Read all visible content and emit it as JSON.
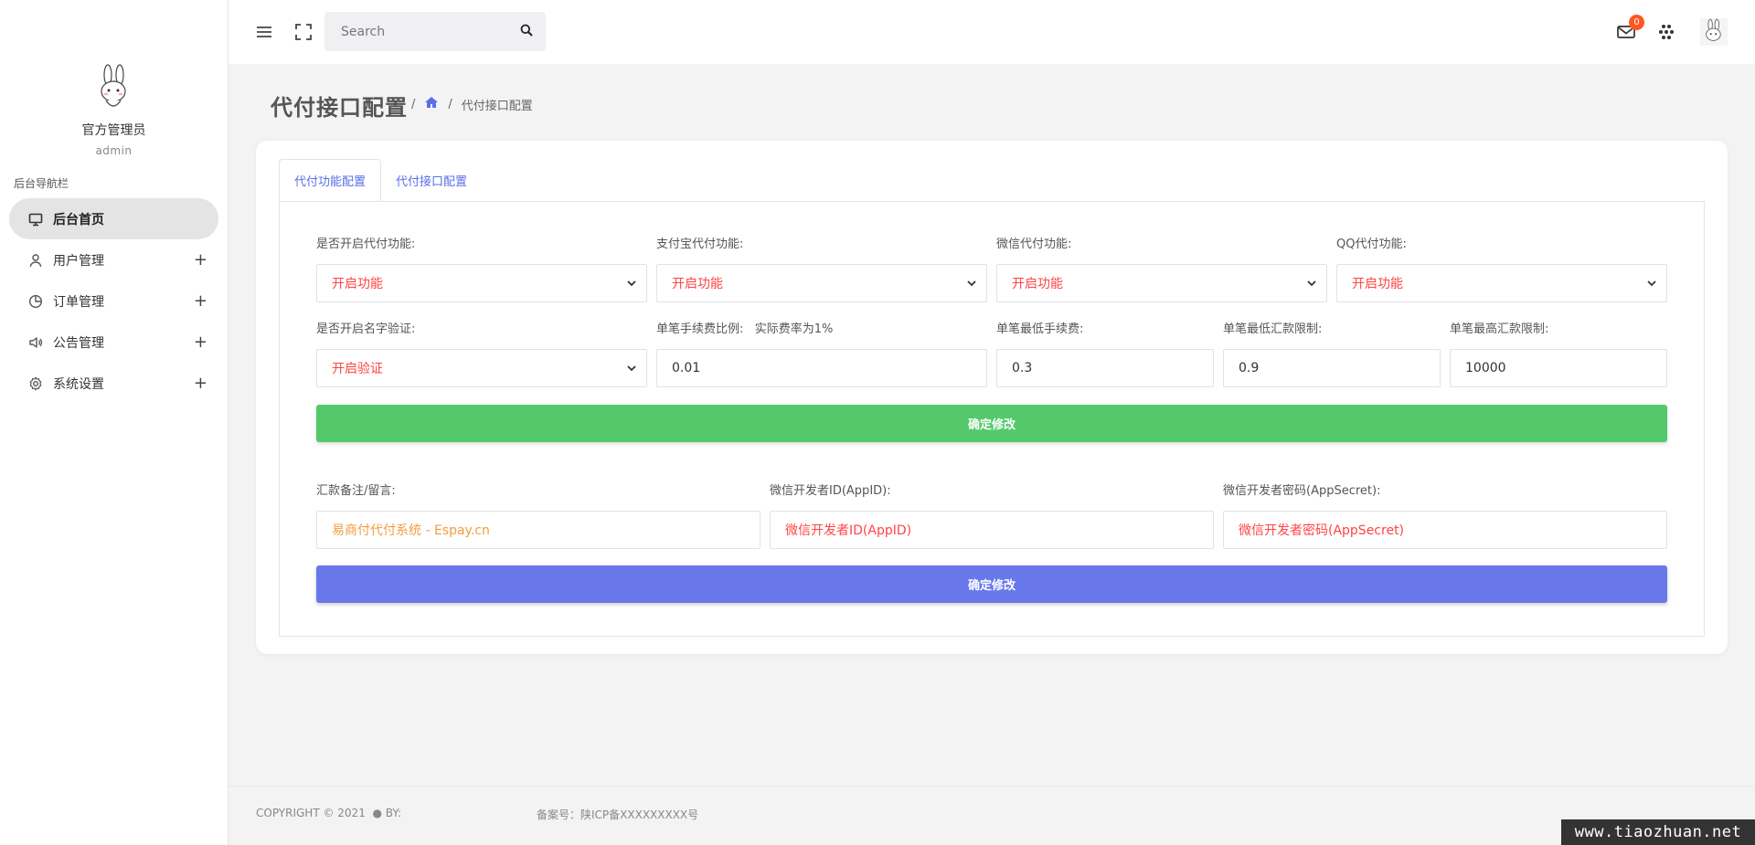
{
  "sidebar": {
    "user_name": "官方管理员",
    "user_role": "admin",
    "nav_caption": "后台导航栏",
    "items": [
      {
        "label": "后台首页",
        "icon": "monitor-icon"
      },
      {
        "label": "用户管理",
        "icon": "user-icon"
      },
      {
        "label": "订单管理",
        "icon": "pie-chart-icon"
      },
      {
        "label": "公告管理",
        "icon": "speaker-icon"
      },
      {
        "label": "系统设置",
        "icon": "gear-icon"
      }
    ]
  },
  "topbar": {
    "search_placeholder": "Search",
    "mail_count": "0"
  },
  "page": {
    "title": "代付接口配置",
    "breadcrumb_sep": "/",
    "breadcrumb_current": "代付接口配置"
  },
  "tabs": [
    "代付功能配置",
    "代付接口配置"
  ],
  "form1": {
    "row1": [
      {
        "label": "是否开启代付功能:",
        "value": "开启功能"
      },
      {
        "label": "支付宝代付功能:",
        "value": "开启功能"
      },
      {
        "label": "微信代付功能:",
        "value": "开启功能"
      },
      {
        "label": "QQ代付功能:",
        "value": "开启功能"
      }
    ],
    "row2": [
      {
        "label": "是否开启名字验证:",
        "value": "开启验证"
      },
      {
        "label": "单笔手续费比例:   实际费率为1%",
        "value": "0.01"
      },
      {
        "label": "单笔最低手续费:",
        "value": "0.3"
      },
      {
        "label": "单笔最低汇款限制:",
        "value": "0.9"
      },
      {
        "label": "单笔最高汇款限制:",
        "value": "10000"
      }
    ],
    "submit": "确定修改"
  },
  "form2": {
    "fields": [
      {
        "label": "汇款备注/留言:",
        "value": "易商付代付系统 - Espay.cn"
      },
      {
        "label": "微信开发者ID(AppID):",
        "value": "微信开发者ID(AppID)"
      },
      {
        "label": "微信开发者密码(AppSecret):",
        "value": "微信开发者密码(AppSecret)"
      }
    ],
    "submit": "确定修改"
  },
  "footer": {
    "copyright": "COPYRIGHT © 2021  ● BY:",
    "icp": "备案号：陕ICP备XXXXXXXXX号"
  },
  "watermark": "www.tiaozhuan.net",
  "colors": {
    "accent": "#6878ea",
    "success": "#53c96b",
    "danger_text": "#ff4444",
    "warning_text": "#f39c40",
    "badge": "#ff5722"
  }
}
